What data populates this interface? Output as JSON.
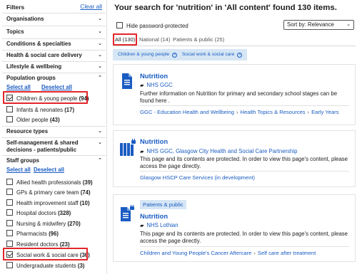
{
  "sidebar": {
    "filters_label": "Filters",
    "clear_all": "Clear all",
    "categories": {
      "organisations": "Organisations",
      "topics": "Topics",
      "conditions": "Conditions & specialties",
      "delivery": "Health & social care delivery",
      "lifestyle": "Lifestyle & wellbeing",
      "population": "Population groups",
      "resource": "Resource types",
      "selfmgmt_1": "Self-management & shared",
      "selfmgmt_2": "decisions - patients/public",
      "staff": "Staff groups"
    },
    "select_all": "Select all",
    "deselect_all": "Deselect all",
    "population_items": [
      {
        "label": "Children & young people",
        "count": "(94)",
        "checked": true
      },
      {
        "label": "Infants & neonates",
        "count": "(17)",
        "checked": false
      },
      {
        "label": "Older people",
        "count": "(43)",
        "checked": false
      }
    ],
    "staff_items": [
      {
        "label": "Allied health professionals",
        "count": "(39)",
        "checked": false
      },
      {
        "label": "GPs & primary care team",
        "count": "(74)",
        "checked": false
      },
      {
        "label": "Health improvement staff",
        "count": "(10)",
        "checked": false
      },
      {
        "label": "Hospital doctors",
        "count": "(328)",
        "checked": false
      },
      {
        "label": "Nursing & midwifery",
        "count": "(270)",
        "checked": false
      },
      {
        "label": "Pharmacists",
        "count": "(96)",
        "checked": false
      },
      {
        "label": "Resident doctors",
        "count": "(23)",
        "checked": false
      },
      {
        "label": "Social work & social care",
        "count": "(36)",
        "checked": true
      },
      {
        "label": "Undergraduate students",
        "count": "(3)",
        "checked": false
      }
    ]
  },
  "main": {
    "title": "Your search for 'nutrition' in 'All content' found 130 items.",
    "hide_password_label": "Hide password-protected",
    "sort_label": "Sort by:  Relevance",
    "tabs": [
      {
        "label": "All (130)"
      },
      {
        "label": "National (14)"
      },
      {
        "label": "Patients & public (25)"
      }
    ],
    "chips": [
      "Children & young people",
      "Social work & social care"
    ],
    "results": [
      {
        "title": "Nutrition",
        "source": "NHS GGC",
        "description": "Further information on Nutrition for primary and secondary school stages can be found here .",
        "breadcrumbs": [
          "GGC - Education Health and Wellbeing",
          "Health Topics & Resources",
          "Early Years"
        ]
      },
      {
        "title": "Nutrition",
        "source": "NHS GGC, Glasgow City Health and Social Care Partnership",
        "description": "This page and its contents are protected. In order to view this page's content, please access the page directly.",
        "breadcrumbs": [
          "Glasgow HSCP Care Services (in development)"
        ]
      },
      {
        "badge": "Patients & public",
        "title": "Nutrition",
        "source": "NHS Lothian",
        "description": "This page and its contents are protected. In order to view this page's content, please access the page directly.",
        "breadcrumbs": [
          "Children and Young People's Cancer Aftercare",
          "Self care after treatment"
        ]
      }
    ]
  },
  "colors": {
    "link": "#1a5cc2",
    "highlight": "#e3262b",
    "chip_bg": "#d6e6f5"
  }
}
